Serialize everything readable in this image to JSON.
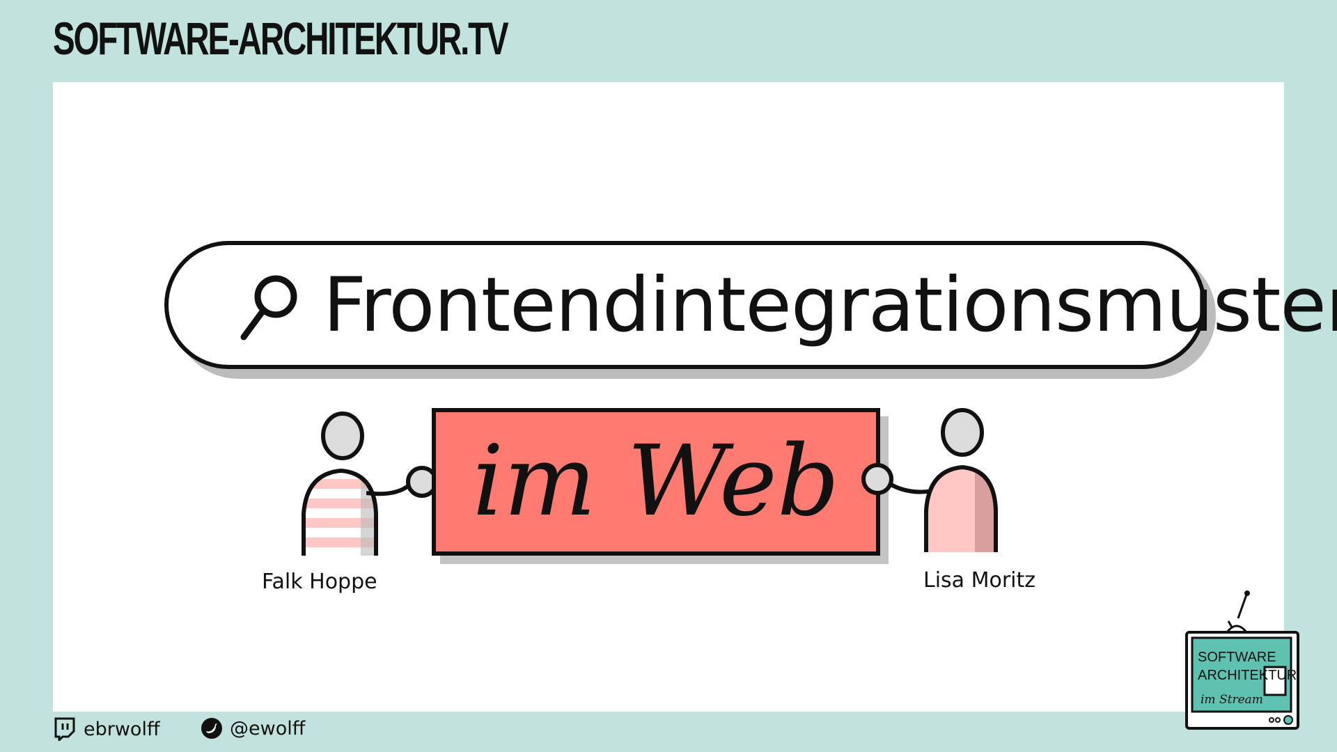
{
  "header": {
    "site_title": "SOFTWARE-ARCHITEKTUR.TV"
  },
  "main": {
    "search_text": "Frontendintegrationsmuster",
    "sign_text": "im Web",
    "people": [
      {
        "name": "Falk Hoppe"
      },
      {
        "name": "Lisa Moritz"
      }
    ]
  },
  "footer": {
    "twitch_handle": "ebrwolff",
    "twitter_handle": "@ewolff"
  },
  "logo": {
    "line1": "SOFTWARE",
    "line2": "ARCHITEKTUR",
    "line3": "im Stream"
  },
  "colors": {
    "background": "#c2e2dd",
    "sign": "#ff7a70",
    "shirt_stripe": "#ffc7c4",
    "tv_screen": "#5fc1b0"
  }
}
